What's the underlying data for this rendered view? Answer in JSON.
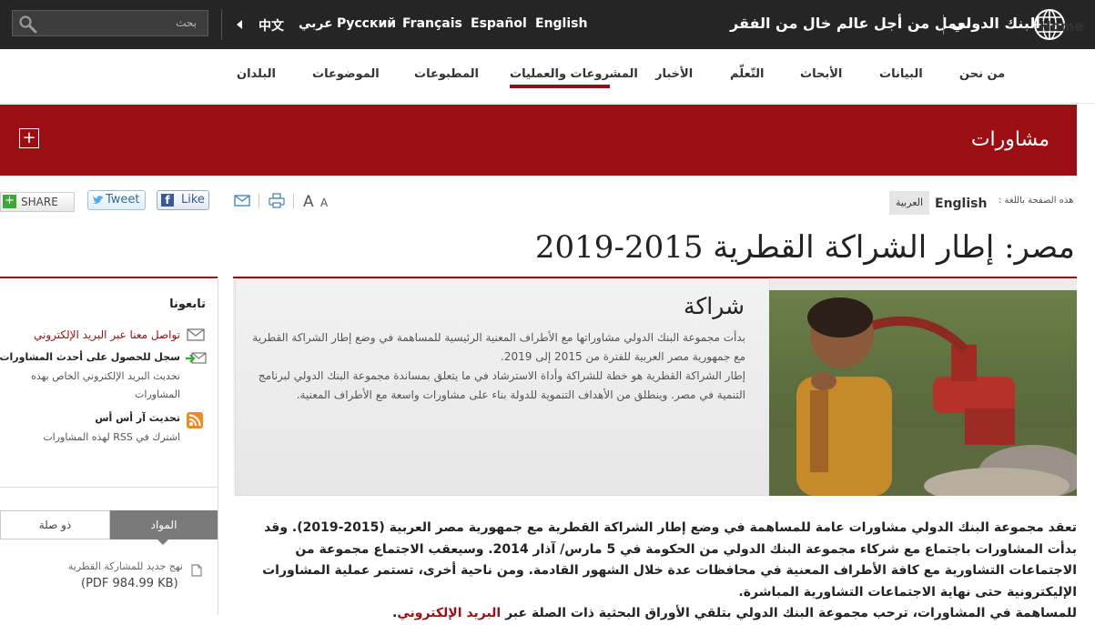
{
  "header": {
    "search_placeholder": "بحث",
    "languages": [
      "中文",
      "عربي",
      "Русский",
      "Français",
      "Español",
      "English"
    ],
    "slogan": "نعمل من أجل عالم خال من الفقر",
    "brand": "البنك الدولي"
  },
  "nav": {
    "home": "Home",
    "items": [
      "من نحن",
      "البيانات",
      "الأبحاث",
      "التّعلّم",
      "الأخبار",
      "المشروعات والعمليات",
      "المطبوعات",
      "الموضوعات",
      "البلدان"
    ]
  },
  "banner": {
    "title": "مشاورات",
    "expand": "+"
  },
  "tools": {
    "share": "SHARE",
    "tweet": "Tweet",
    "like": "Like",
    "font_large": "A",
    "font_small": "A",
    "lang_label": "هذه الصفحة باللغة :",
    "lang_en": "English",
    "lang_ar": "العربية"
  },
  "page": {
    "title": "مصر: إطار الشراكة القطرية 2015-2019"
  },
  "hero": {
    "heading": "شراكة",
    "paragraph1": "بدأت مجموعة البنك الدولي مشاوراتها مع الأطراف المعنية الرئيسية للمساهمة في وضع إطار الشراكة القطرية مع جمهورية مصر العربية للفترة من 2015 إلى 2019.",
    "paragraph2": "إطار الشراكة القطرية هو خطة للشراكة وأداة الاسترشاد في ما يتعلق بمساندة مجموعة البنك الدولي لبرنامج التنمية في مصر. وينطلق من الأهداف التنموية للدولة بناء على مشاورات واسعة مع الأطراف المعنية."
  },
  "sidebar": {
    "follow_heading": "تابعونا",
    "email_link": "تواصل معنا عبر البريد الإلكتروني",
    "signup_title": "سجل للحصول على أحدث المشاورات",
    "signup_line1": "تحديث البريد الإلكتروني الخاص بهذه",
    "signup_line2": "المشاورات",
    "rss_title": "تحديث آر أس أس",
    "rss_desc": "اشترك في RSS لهذه المشاورات",
    "tab_materials": "المواد",
    "tab_related": "ذو صلة",
    "doc_title": "نهج جديد للمشاركة القطرية",
    "doc_pdf": "PDF",
    "doc_size": "(PDF 984.99 KB)"
  },
  "body": {
    "para1": "تعقد مجموعة البنك الدولي مشاورات عامة للمساهمة في وضع إطار الشراكة القطرية مع جمهورية مصر العربية (2015-2019). وقد بدأت المشاورات باجتماع مع شركاء مجموعة البنك الدولي من الحكومة في 5 مارس/ آذار 2014. وسيعقب الاجتماع مجموعة من الاجتماعات التشاورية مع كافة الأطراف المعنية في محافظات عدة خلال الشهور القادمة. ومن ناحية أخرى، تستمر عملية المشاورات الإليكترونية حتى نهاية الاجتماعات التشاورية المباشرة.",
    "para2_text": "للمساهمة في المشاورات، ترحب مجموعة البنك الدولي بتلقي الأوراق البحثية ذات الصلة عبر ",
    "para2_link": "البريد الإلكتروني",
    "para2_end": "."
  },
  "colors": {
    "brand_red": "#9b0f14",
    "topbar": "#252525"
  }
}
